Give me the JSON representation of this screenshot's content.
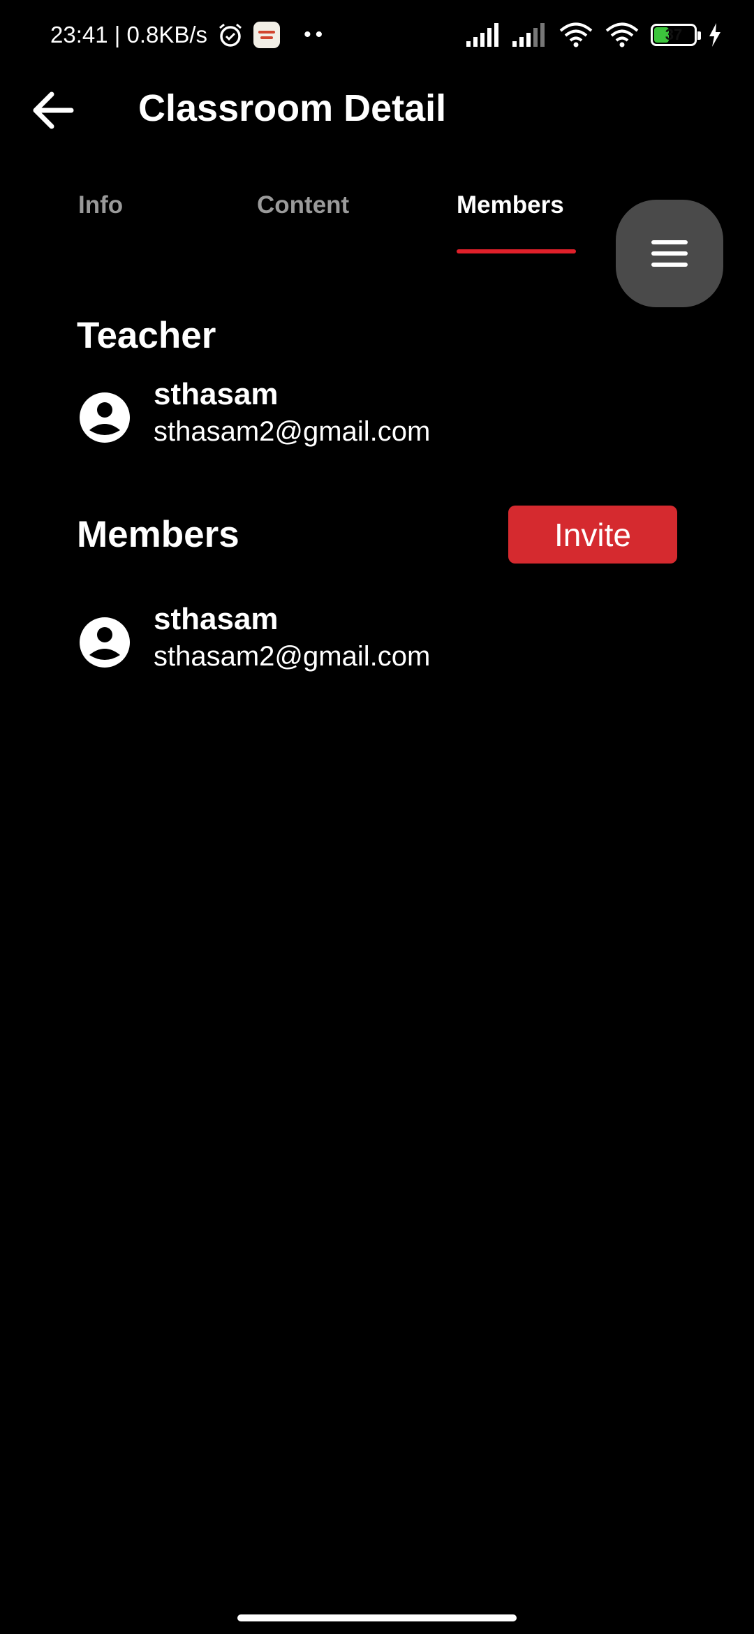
{
  "status_bar": {
    "time_speed": "23:41 | 0.8KB/s",
    "battery_level": "37",
    "icons": [
      "alarm-icon",
      "app-notification-icon",
      "more-dots-icon",
      "signal-icon",
      "signal-icon",
      "wifi-icon",
      "wifi-icon",
      "battery-icon",
      "charging-icon"
    ]
  },
  "app_bar": {
    "title": "Classroom Detail"
  },
  "tabs": [
    {
      "label": "Info"
    },
    {
      "label": "Content"
    },
    {
      "label": "Members"
    }
  ],
  "active_tab": "Members",
  "teacher_section": {
    "title": "Teacher",
    "person": {
      "name": "sthasam",
      "email": "sthasam2@gmail.com"
    }
  },
  "members_section": {
    "title": "Members",
    "invite_label": "Invite",
    "people": [
      {
        "name": "sthasam",
        "email": "sthasam2@gmail.com"
      }
    ]
  },
  "colors": {
    "background": "#000000",
    "accent_red": "#d52a2f",
    "tab_indicator": "#e0202a",
    "fab_background": "#4a4a4a",
    "inactive_tab": "#9a9a9a"
  }
}
